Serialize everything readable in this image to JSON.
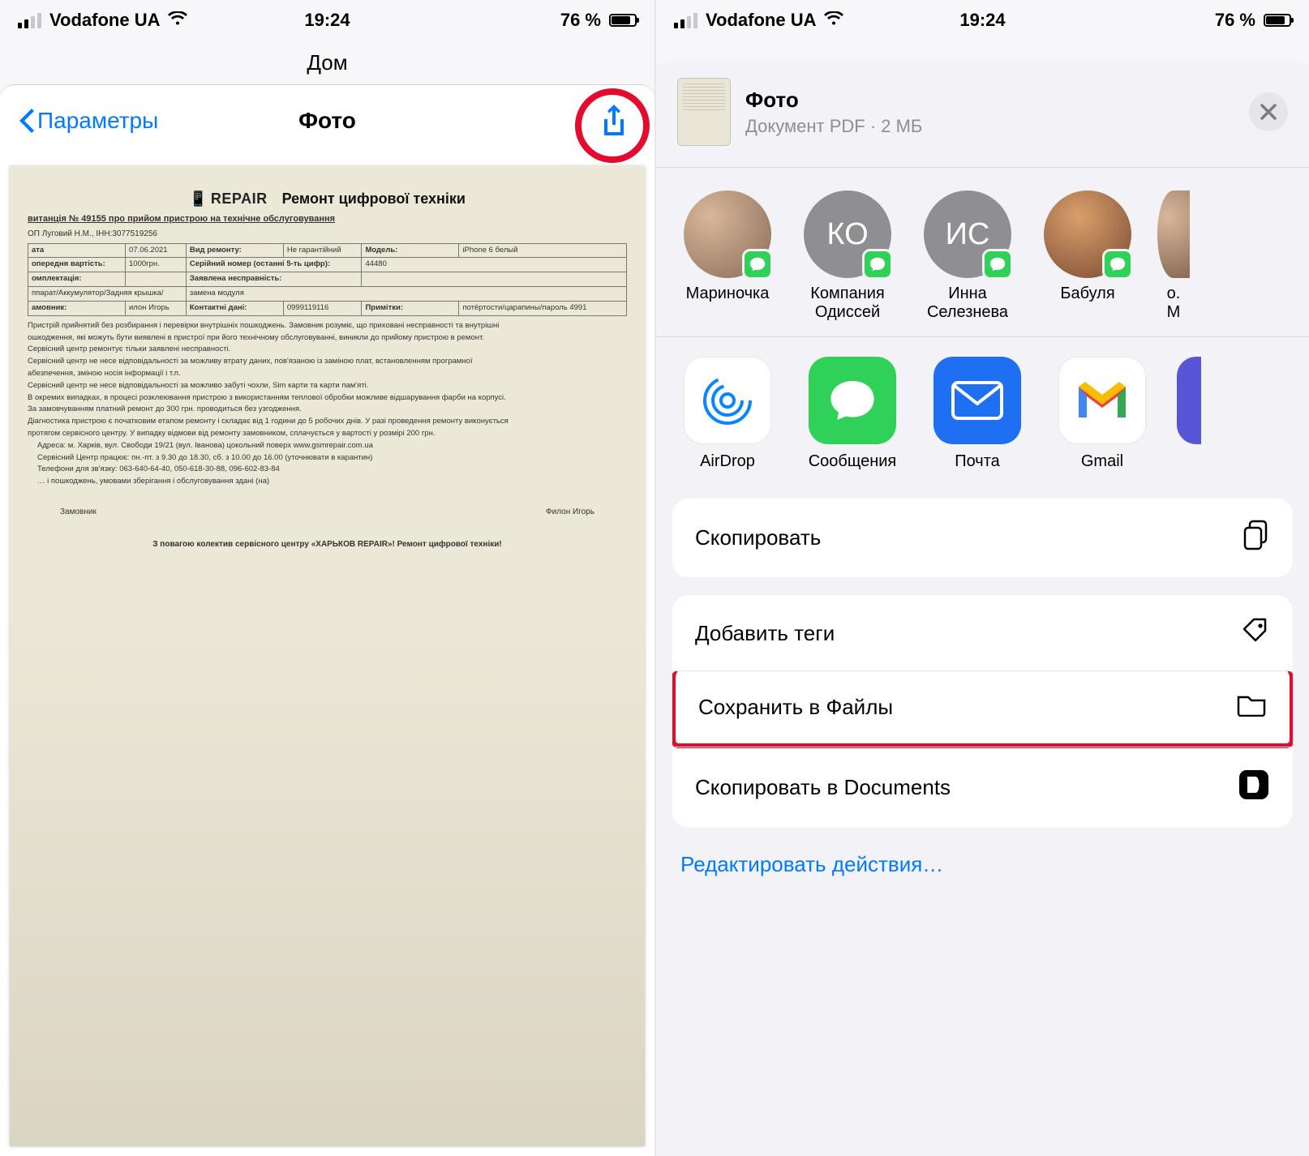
{
  "status": {
    "carrier": "Vodafone UA",
    "time": "19:24",
    "battery_pct": "76 %"
  },
  "left": {
    "back_label": "Параметры",
    "title": "Фото",
    "under_title": "Дом",
    "doc": {
      "logo": "REPAIR",
      "title": "Ремонт цифрової техніки",
      "receipt_line": "витанція № 49155 про прийом пристрою на технічне обслуговування",
      "fop": "ОП Луговий Н.М., ІНН:3077519256",
      "rows": {
        "date_k": "ата",
        "date_v": "07.06.2021",
        "type_k": "Вид ремонту:",
        "type_v": "Не гарантійний",
        "model_k": "Модель:",
        "model_v": "iPhone  6 белый",
        "prepay_k": "опередня вартість:",
        "prepay_v": "1000грн.",
        "serial_k": "Серійний номер (останні 5-ть цифр):",
        "serial_v": "44480",
        "kit_k": "омплектація:",
        "kit_v": "",
        "fault_k": "Заявлена несправність:",
        "fault_v": "",
        "device_k": "ппарат/Аккумулятор/Задняя крышка/",
        "device_v": "замена модуля",
        "owner_k": "амовник:",
        "owner_v": "",
        "contact_k": "Контактні дані:",
        "contact_v": "0999119116",
        "notes_k": "Примітки:",
        "notes_v": "потёртости/царапины/пароль 4991",
        "owner_name": "илон Игорь"
      },
      "body": [
        "Пристрій прийнятий без розбирання і перевірки внутрішніх пошкоджень. Замовник розуміє, що приховані несправності та внутрішні",
        "ошкодження, які можуть бути виявлені в пристрої при його технічному обслуговуванні, виникли до прийому пристрою в ремонт.",
        "Сервісний центр ремонтує тільки заявлені несправності.",
        "Сервісний центр не несе відповідальності за можливу втрату даних, пов'язаною із заміною плат, встановленням програмної",
        "абезпечення, зміною носія інформації і т.п.",
        "Сервісний центр не несе відповідальності за можливо забуті чохли, Sim карти та карти пам'яті.",
        "В окремих випадках, в процесі розклеювання пристрою з використанням теплової обробки можливе відшарування фарби на корпусі.",
        "За замовчуванням платний ремонт до 300 грн. проводиться без узгодження.",
        "Діагностика пристрою є початковим етапом ремонту і складає від 1 години до 5 робочих днів. У разі проведення ремонту виконується",
        "протягом сервісного центру. У випадку відмови від ремонту замовником, сплачується у вартості у розмірі 200 грн."
      ],
      "addr": "Адреса: м. Харків, вул. Свободи 19/21 (вул. Іванова) цокольний поверх www.gsmrepair.com.ua",
      "hours": "Сервісний Центр працює: пн.-пт. з 9.30 до 18.30, сб. з 10.00 до 16.00 (уточнювати в карантин)",
      "tel": "Телефони для зв'язку: 063-640-64-40, 050-618-30-88, 096-602-83-84",
      "storage": "… і пошкоджень, умовами зберігання і обслуговування здані (на)",
      "sign_l": "Замовник",
      "sign_r": "Филон Игорь",
      "footer": "З повагою колектив сервісного центру «ХАРЬКОВ REPAIR»! Ремонт цифрової техніки!"
    }
  },
  "right": {
    "file": {
      "title": "Фото",
      "subtitle": "Документ PDF · 2 МБ"
    },
    "contacts": [
      {
        "name": "Мариночка",
        "name2": "",
        "avatar": "photo1",
        "initials": ""
      },
      {
        "name": "Компания",
        "name2": "Одиссей",
        "avatar": "init",
        "initials": "КО"
      },
      {
        "name": "Инна",
        "name2": "Селезнева",
        "avatar": "init",
        "initials": "ИС"
      },
      {
        "name": "Бабуля",
        "name2": "",
        "avatar": "photo2",
        "initials": ""
      },
      {
        "name": "о.",
        "name2": "М",
        "avatar": "photo1",
        "initials": ""
      }
    ],
    "apps": [
      {
        "name": "AirDrop",
        "kind": "airdrop"
      },
      {
        "name": "Сообщения",
        "kind": "msg"
      },
      {
        "name": "Почта",
        "kind": "mail"
      },
      {
        "name": "Gmail",
        "kind": "gmail"
      },
      {
        "name": "",
        "kind": "extra"
      }
    ],
    "actions": {
      "copy": "Скопировать",
      "tags": "Добавить теги",
      "save_files": "Сохранить в Файлы",
      "copy_docs": "Скопировать в Documents"
    },
    "edit_actions": "Редактировать действия…"
  }
}
